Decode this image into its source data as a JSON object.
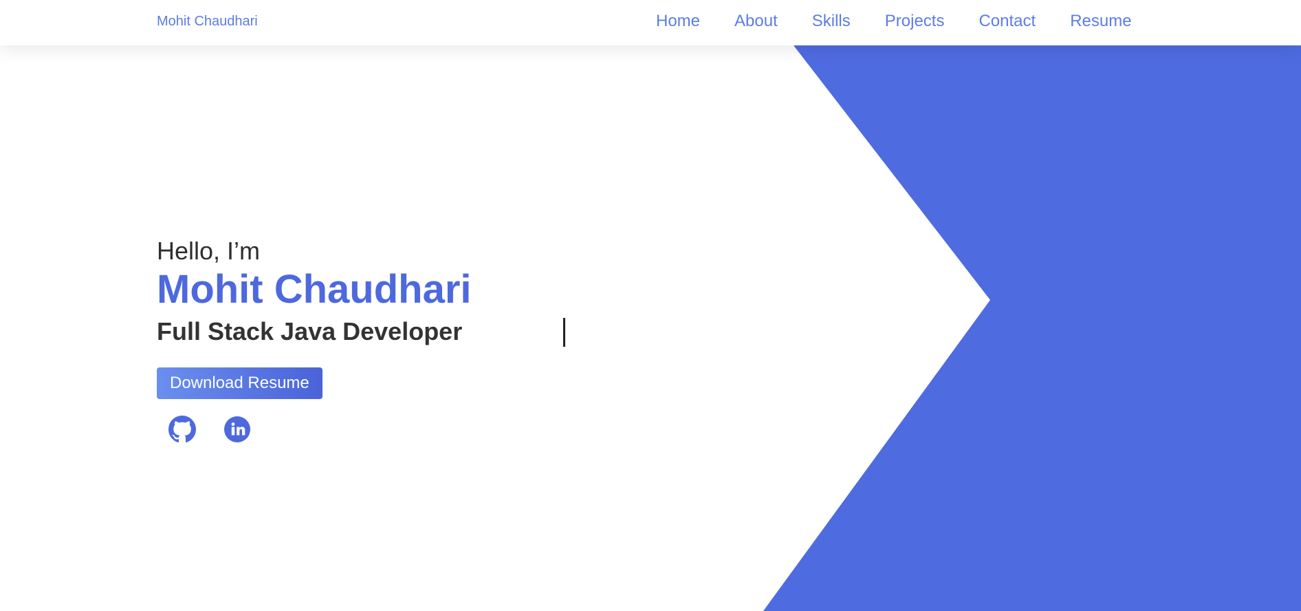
{
  "nav": {
    "brand": "Mohit Chaudhari",
    "links": [
      "Home",
      "About",
      "Skills",
      "Projects",
      "Contact",
      "Resume"
    ]
  },
  "hero": {
    "greeting": "Hello, I’m",
    "name": "Mohit Chaudhari",
    "role": "Full Stack Java Developer",
    "download_label": "Download Resume"
  },
  "socials": [
    {
      "icon": "github-icon"
    },
    {
      "icon": "linkedin-icon"
    }
  ],
  "colors": {
    "accent": "#4e69dd",
    "nav_text": "#5c7ce6",
    "shape": "#4f6be0",
    "text_dark": "#333333"
  }
}
